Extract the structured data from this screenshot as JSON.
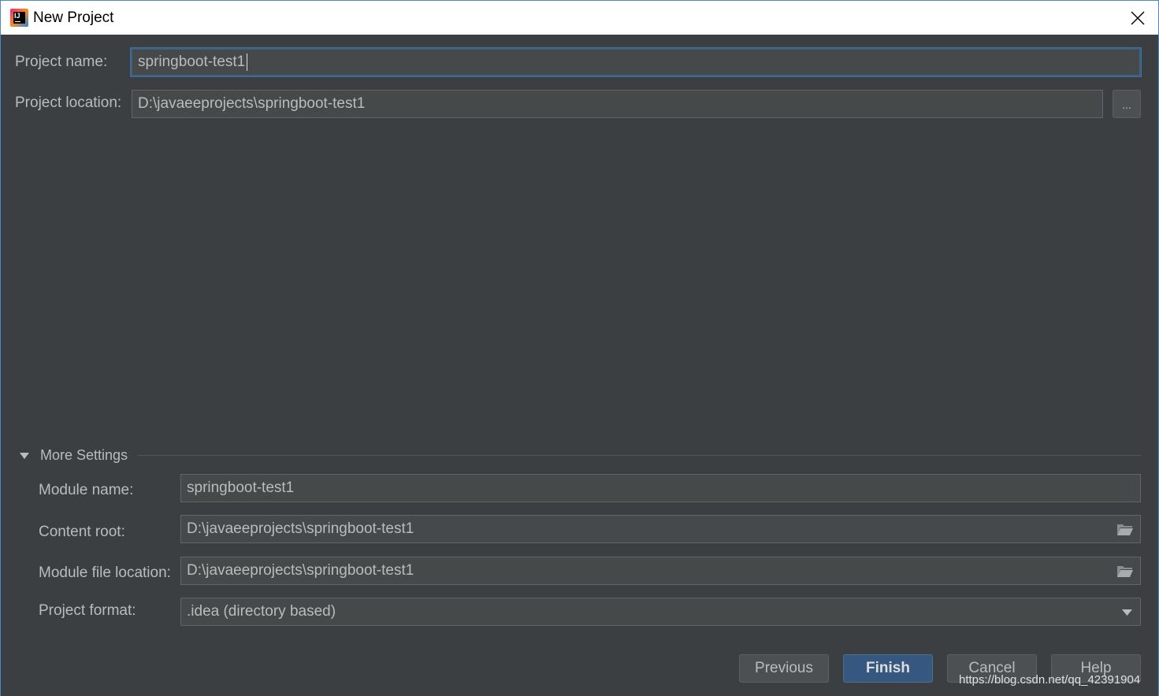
{
  "window": {
    "title": "New Project",
    "app_icon": "intellij-idea-icon",
    "close_icon": "close-icon"
  },
  "form": {
    "project_name_label": "Project name:",
    "project_name_value": "springboot-test1",
    "project_location_label": "Project location:",
    "project_location_value": "D:\\javaeeprojects\\springboot-test1",
    "browse_label": "..."
  },
  "more_settings": {
    "title": "More Settings",
    "expanded": true,
    "module_name_label": "Module name:",
    "module_name_value": "springboot-test1",
    "content_root_label": "Content root:",
    "content_root_value": "D:\\javaeeprojects\\springboot-test1",
    "module_file_label": "Module file location:",
    "module_file_value": "D:\\javaeeprojects\\springboot-test1",
    "project_format_label": "Project format:",
    "project_format_value": ".idea (directory based)"
  },
  "buttons": {
    "previous": "Previous",
    "finish": "Finish",
    "cancel": "Cancel",
    "help": "Help"
  },
  "watermark": "https://blog.csdn.net/qq_42391904",
  "colors": {
    "background": "#3c3f41",
    "field_bg": "#45494a",
    "primary_button": "#365880",
    "focus_border": "#3d6185",
    "text": "#bbbbbb"
  }
}
